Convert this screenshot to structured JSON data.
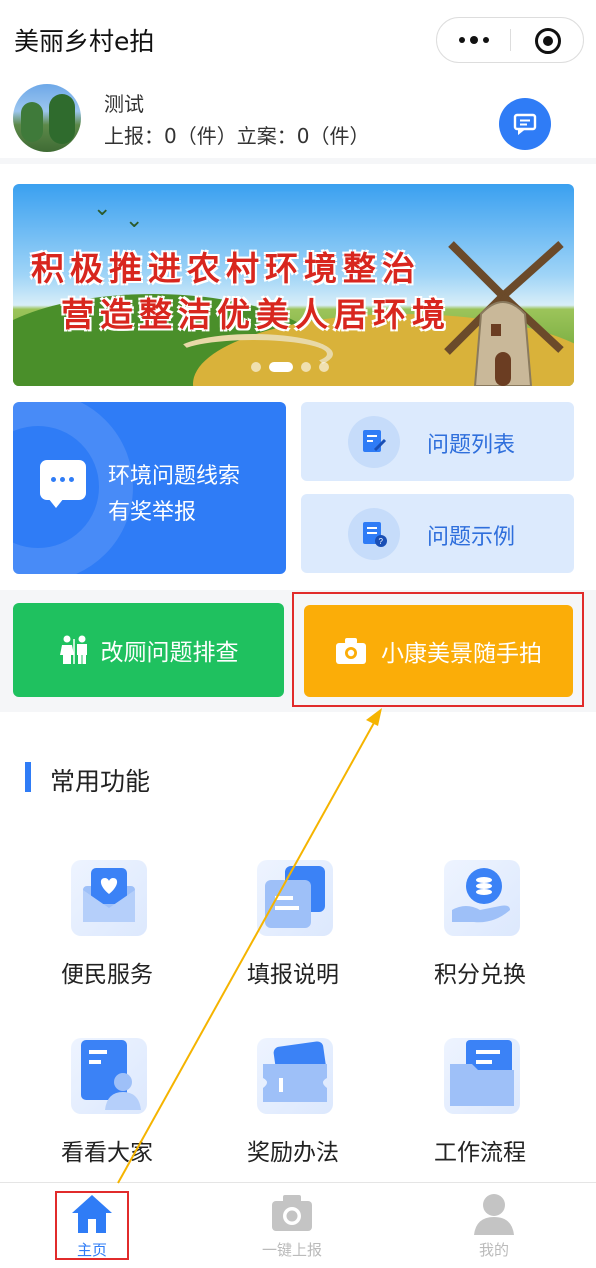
{
  "app": {
    "title": "美丽乡村e拍",
    "more_icon": "more-dots-icon",
    "close_icon": "target-close-icon"
  },
  "user": {
    "name": "测试",
    "stats": "上报：0（件）立案：0（件）",
    "message_icon": "message-icon"
  },
  "banner": {
    "line1": "积极推进农村环境整治",
    "line2": "营造整洁优美人居环境",
    "active_slide": 2,
    "slide_count": 4
  },
  "cards": {
    "report": {
      "line1": "环境问题线索",
      "line2": "有奖举报",
      "icon": "chat-bubble-icon"
    },
    "list": {
      "label": "问题列表",
      "icon": "edit-document-icon"
    },
    "example": {
      "label": "问题示例",
      "icon": "document-help-icon"
    }
  },
  "actions": {
    "toilet": {
      "label": "改厕问题排查",
      "icon": "restroom-icon"
    },
    "photo": {
      "label": "小康美景随手拍",
      "icon": "camera-icon"
    }
  },
  "section": {
    "title": "常用功能"
  },
  "functions": [
    {
      "label": "便民服务",
      "icon": "heart-mail-icon"
    },
    {
      "label": "填报说明",
      "icon": "form-cards-icon"
    },
    {
      "label": "积分兑换",
      "icon": "coin-hand-icon"
    },
    {
      "label": "看看大家",
      "icon": "user-document-icon"
    },
    {
      "label": "奖励办法",
      "icon": "ticket-icon"
    },
    {
      "label": "工作流程",
      "icon": "folder-icon"
    }
  ],
  "tabs": [
    {
      "label": "主页",
      "icon": "home-icon",
      "active": true
    },
    {
      "label": "一键上报",
      "icon": "camera-icon",
      "active": false
    },
    {
      "label": "我的",
      "icon": "user-icon",
      "active": false
    }
  ],
  "colors": {
    "primary": "#2f7cf6",
    "green": "#1fc15f",
    "orange": "#fbad08",
    "highlight": "#e12b2b",
    "arrow": "#f5b400"
  }
}
